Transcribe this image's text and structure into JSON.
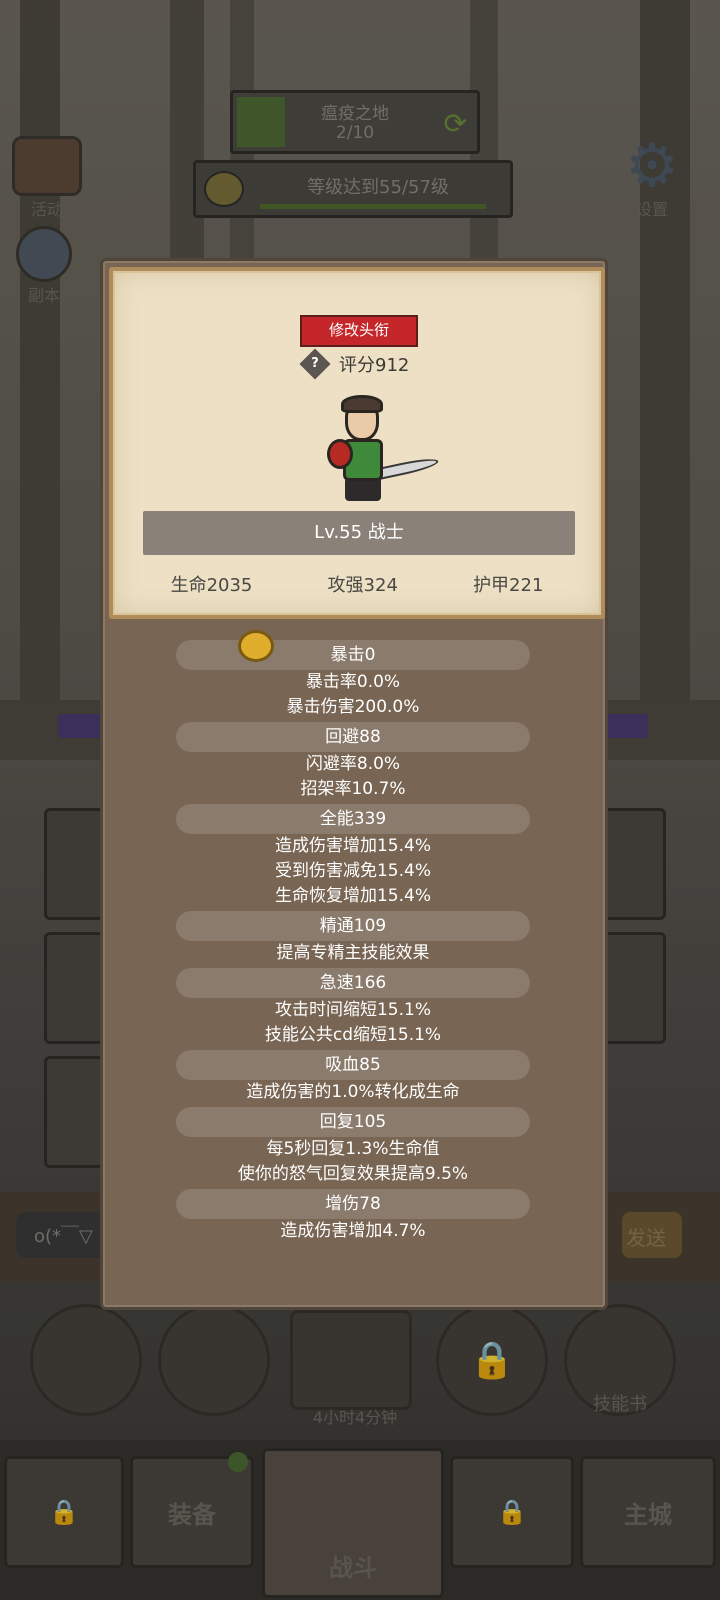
{
  "scene": {
    "region_name": "瘟疫之地",
    "region_progress": "2/10",
    "quest_text": "等级达到55/57级",
    "activity_label": "活动",
    "dungeon_label": "副本",
    "settings_label": "设置",
    "chat_placeholder": "o(*￣▽",
    "send_label": "发送",
    "chest_timer": "4小时4分钟",
    "skillbook_label": "技能书",
    "nav": [
      "",
      "装备",
      "战斗",
      "",
      "主城"
    ]
  },
  "profile": {
    "title_button": "修改头衔",
    "help_glyph": "?",
    "score": "评分912",
    "level_class": "Lv.55 战士",
    "stats": [
      "生命2035",
      "攻强324",
      "护甲221"
    ]
  },
  "attributes": [
    {
      "head": "暴击0",
      "lines": [
        "暴击率0.0%",
        "暴击伤害200.0%"
      ]
    },
    {
      "head": "回避88",
      "lines": [
        "闪避率8.0%",
        "招架率10.7%"
      ]
    },
    {
      "head": "全能339",
      "lines": [
        "造成伤害增加15.4%",
        "受到伤害减免15.4%",
        "生命恢复增加15.4%"
      ]
    },
    {
      "head": "精通109",
      "lines": [
        "提高专精主技能效果"
      ]
    },
    {
      "head": "急速166",
      "lines": [
        "攻击时间缩短15.1%",
        "技能公共cd缩短15.1%"
      ]
    },
    {
      "head": "吸血85",
      "lines": [
        "造成伤害的1.0%转化成生命"
      ]
    },
    {
      "head": "回复105",
      "lines": [
        "每5秒回复1.3%生命值",
        "使你的怒气回复效果提高9.5%"
      ]
    },
    {
      "head": "增伤78",
      "lines": [
        "造成伤害增加4.7%"
      ]
    }
  ],
  "colors": {
    "panel_bg": "#786553",
    "card_bg": "#ede0c4",
    "title_button": "#c4262a",
    "attr_pill": "#8a7b6c"
  }
}
